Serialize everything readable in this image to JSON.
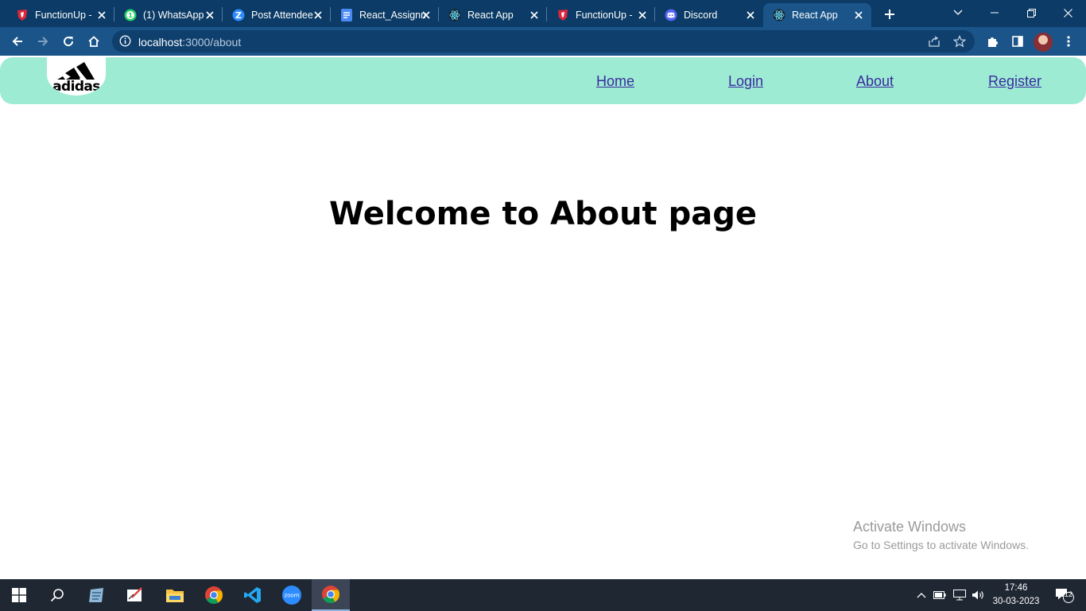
{
  "browser": {
    "tabs": [
      {
        "title": "FunctionUp -",
        "icon": "functionup-icon"
      },
      {
        "title": "(1) WhatsApp",
        "icon": "whatsapp-icon"
      },
      {
        "title": "Post Attendee",
        "icon": "zoom-z-icon"
      },
      {
        "title": "React_Assignm",
        "icon": "google-docs-icon"
      },
      {
        "title": "React App",
        "icon": "react-icon"
      },
      {
        "title": "FunctionUp -",
        "icon": "functionup-icon"
      },
      {
        "title": "Discord",
        "icon": "discord-icon"
      },
      {
        "title": "React App",
        "icon": "react-icon",
        "active": true
      }
    ],
    "url_host": "localhost",
    "url_path": ":3000/about"
  },
  "page": {
    "logo_text": "adidas",
    "nav": {
      "home": "Home",
      "login": "Login",
      "about": "About",
      "register": "Register"
    },
    "heading": "Welcome to About page"
  },
  "watermark": {
    "title": "Activate Windows",
    "subtitle": "Go to Settings to activate Windows."
  },
  "taskbar": {
    "time": "17:46",
    "date": "30-03-2023",
    "notification_count": "12"
  },
  "colors": {
    "navbar": "#9eebd4",
    "nav_link": "#3a2b9e",
    "tabstrip": "#0b3b66",
    "toolbar": "#1a5489"
  }
}
